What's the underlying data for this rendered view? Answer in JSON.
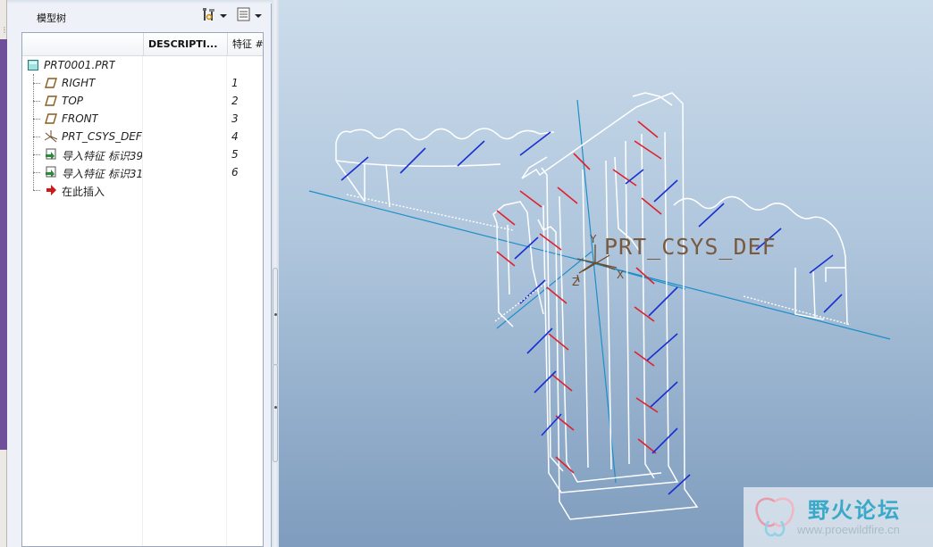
{
  "panel": {
    "title": "模型树",
    "toolbar": [
      {
        "name": "tree-settings",
        "icon": "tools-icon"
      },
      {
        "name": "tree-columns",
        "icon": "list-settings-icon"
      }
    ]
  },
  "tree": {
    "columns": [
      "DESCRIPTI...",
      "特征 #"
    ],
    "rows": [
      {
        "label": "PRT0001.PRT",
        "num": "",
        "icon": "part-icon"
      },
      {
        "label": "RIGHT",
        "num": "1",
        "icon": "datum-plane-icon"
      },
      {
        "label": "TOP",
        "num": "2",
        "icon": "datum-plane-icon"
      },
      {
        "label": "FRONT",
        "num": "3",
        "icon": "datum-plane-icon"
      },
      {
        "label": "PRT_CSYS_DEF",
        "num": "4",
        "icon": "coordinate-system-icon"
      },
      {
        "label": "导入特征 标识39",
        "num": "5",
        "icon": "import-feature-icon"
      },
      {
        "label": "导入特征 标识31",
        "num": "6",
        "icon": "import-feature-icon"
      },
      {
        "label": "在此插入",
        "num": "",
        "icon": "insert-here-arrow-icon"
      }
    ]
  },
  "graphics": {
    "csys_label": "PRT_CSYS_DEF",
    "axis_labels": {
      "x": "X",
      "y": "Y",
      "z": "Z"
    },
    "background_top": "#ccdceb",
    "background_bottom": "#7f9cbe",
    "accent_red": "#e0202a",
    "accent_blue": "#1a2fd0"
  },
  "watermark": {
    "title": "野火论坛",
    "url": "www.proewildfire.cn"
  }
}
